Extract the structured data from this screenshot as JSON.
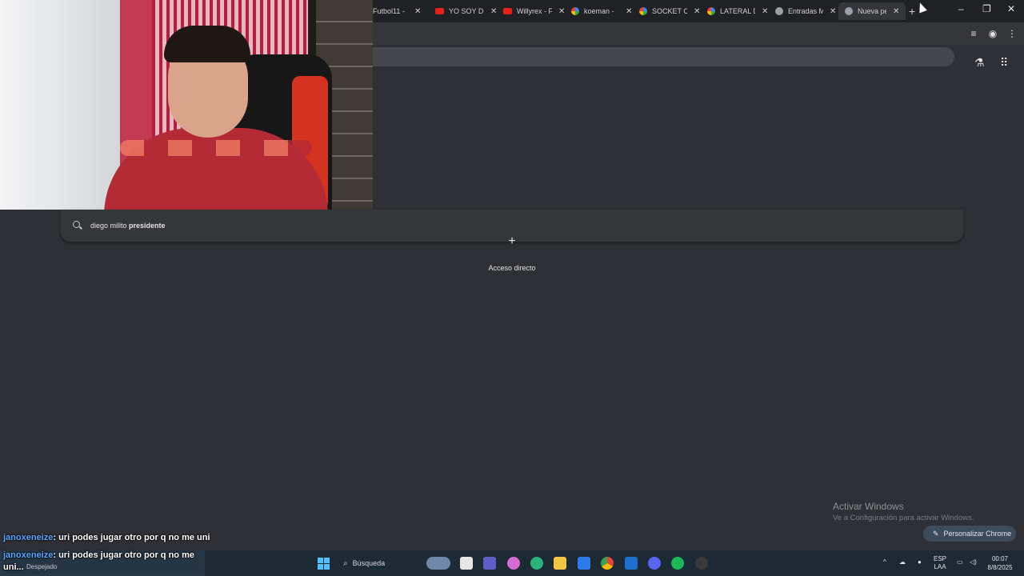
{
  "browser": {
    "tabs": [
      {
        "title": "Futbol11 -",
        "favicon": "generic-icon"
      },
      {
        "title": "YO SOY DI",
        "favicon": "youtube-icon"
      },
      {
        "title": "Willyrex - F",
        "favicon": "youtube-icon"
      },
      {
        "title": "koeman -",
        "favicon": "google-icon"
      },
      {
        "title": "SOCKET CI",
        "favicon": "google-icon"
      },
      {
        "title": "LATERAL D",
        "favicon": "google-icon"
      },
      {
        "title": "Entradas M",
        "favicon": "gear-icon"
      },
      {
        "title": "Nueva pe",
        "favicon": "chrome-icon",
        "active": true
      }
    ],
    "new_tab_symbol": "+",
    "window_controls": {
      "minimize": "–",
      "restore": "❐",
      "close": "✕"
    }
  },
  "omnibox": {
    "suggestion_prefix": "diego milito ",
    "suggestion_bold": "presidente"
  },
  "ntp": {
    "shortcut_plus": "+",
    "shortcut_label": "Acceso directo",
    "customize_label": "Personalizar Chrome",
    "customize_icon": "pencil-icon"
  },
  "activate_windows": {
    "title": "Activar Windows",
    "subtitle": "Ve a Configuración para activar Windows."
  },
  "chat": {
    "message1": {
      "user": "janoxeneize",
      "text": ": uri podes jugar otro por q no me uni"
    },
    "message2": {
      "user": "janoxeneize",
      "text": ": uri podes jugar otro por q no me uni..."
    }
  },
  "taskbar": {
    "weather_label": "Despejado",
    "search_placeholder": "Búsqueda",
    "language": "ESP",
    "layout": "LAA",
    "time": "00:07",
    "date": "8/8/2025",
    "colors": {
      "start": "#4cc2ff",
      "bar": "#1c2a36"
    }
  }
}
